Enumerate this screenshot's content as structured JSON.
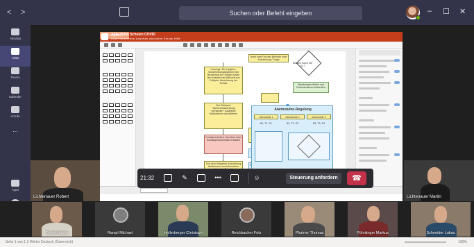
{
  "window": {
    "search_placeholder": "Suchen oder Befehl eingeben",
    "nav_back": "<",
    "nav_forward": ">",
    "controls": {
      "minimize": "–",
      "maximize": "☐",
      "close": "✕"
    }
  },
  "rail": {
    "items": [
      {
        "label": "Aktivität",
        "icon": "bell-icon"
      },
      {
        "label": "Chat",
        "icon": "chat-icon"
      },
      {
        "label": "Teams",
        "icon": "teams-icon"
      },
      {
        "label": "Kalender",
        "icon": "calendar-icon"
      },
      {
        "label": "Anrufe",
        "icon": "phone-icon"
      },
      {
        "label": "...",
        "icon": "more-icon"
      }
    ],
    "bottom": [
      {
        "label": "Apps",
        "icon": "apps-icon"
      },
      {
        "label": "Hilfe",
        "icon": "help-icon"
      }
    ]
  },
  "shared_screen": {
    "doc_title": "Ablaufplan Schulen COVID",
    "menu": "Datei  Bearbeiten  Ansehen  Anordnen  Extras  Hilfe",
    "share_label": "Freigeben",
    "diagram": {
      "left_boxes": [
        "Vorsorge: Die Hygiene-Sicherheitsmaßnahmen bei Bezahlung im Frühjahr sowie den Abstand bei Mahlzeit aus Frühjahr. Abrechnung der Schule",
        "Bei Sichtwort \"Sicherheitsberatung vorhanden\" zusätzlich Maßnahmen durchführen",
        "Kontakt erheben. Kenntnis nach Kontaktpersonenliste erfassen",
        "Von dem Aufgaben-Ausrichtung Abstimmen und Information über die Schule"
      ],
      "side_boxes": [
        "Ersatz-Checkliste COVID-19",
        "Infoblatt BSB Hinweis",
        "Infoblatt Eltern"
      ],
      "top_box": "Anruf oder Fax der Behörde oder Ausrichtung / Frage",
      "decision": "Besuch durch die SL?",
      "note_green": "Nachtrassen fehlen und Dokumentieren einfordern",
      "alarm_title": "Alarmstufen-Regelung",
      "alarm_levels": [
        "Alarmstufe 1",
        "Alarmstufe 2",
        "Alarmstufe 3"
      ],
      "alarm_sub": [
        "B1, T1, S1",
        "B2, T2, S2",
        "B3, T3, S3"
      ],
      "bottom_green": [
        "Erhaltungsmaßnahmen, Frühjahr einsetzen",
        "Checkliste ausgefüllt"
      ],
      "bottom_blue": "Einsatzberichte"
    }
  },
  "meeting": {
    "timer": "21:32",
    "request_control": "Steuerung anfordern",
    "pinned": [
      {
        "name": "Lichtenauer Robert"
      },
      {
        "name": "Lichtenauer Martin"
      }
    ],
    "participants": [
      {
        "name": "Teufel Nicola"
      },
      {
        "name": "Rampl Michael"
      },
      {
        "name": "Hollerberger Christoph"
      },
      {
        "name": "Reichbacher Fritz"
      },
      {
        "name": "Pfurtner Thomas"
      },
      {
        "name": "Pöhnlinger Markus"
      },
      {
        "name": "Schneider Lukas"
      }
    ]
  },
  "status_bar": {
    "left": "Seite 1 von 1    2 Wörter    Deutsch (Österreich)",
    "right": "100%"
  },
  "colors": {
    "teams_dark": "#33344a",
    "accent": "#464775",
    "hangup": "#c4314b",
    "powerpoint": "#c43e1c"
  }
}
